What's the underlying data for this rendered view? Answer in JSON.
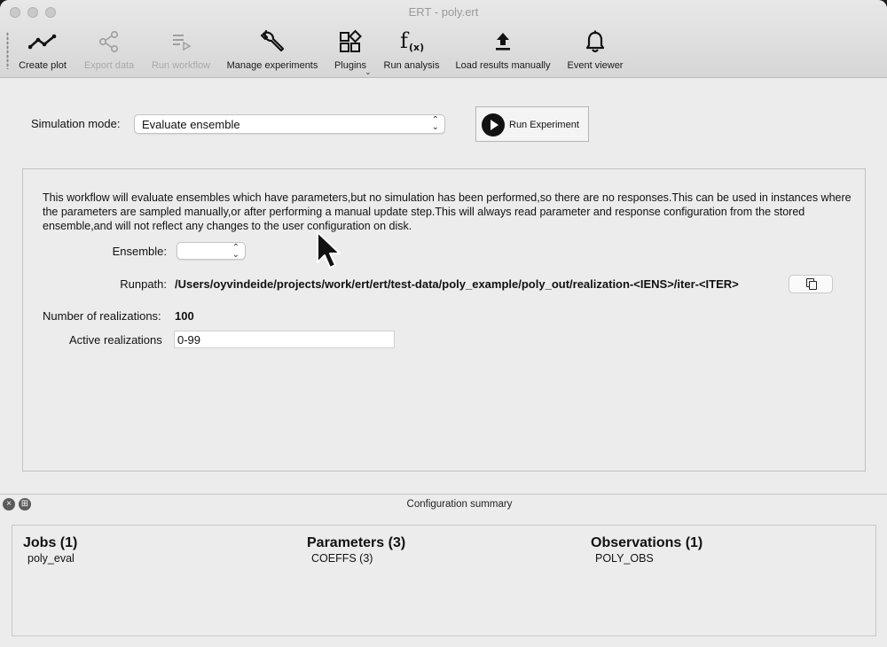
{
  "window": {
    "title": "ERT - poly.ert"
  },
  "toolbar": {
    "create_plot": "Create plot",
    "export_data": "Export data",
    "run_workflow": "Run workflow",
    "manage_experiments": "Manage experiments",
    "plugins": "Plugins",
    "run_analysis": "Run analysis",
    "load_results": "Load results manually",
    "event_viewer": "Event viewer"
  },
  "simulation": {
    "label": "Simulation mode:",
    "selected": "Evaluate ensemble",
    "run_button": "Run Experiment"
  },
  "workflow": {
    "description": "This workflow will evaluate ensembles which have parameters,but no simulation has been performed,so there are no responses.This can be used in instances where the parameters are sampled manually,or after performing a manual update step.This will always read parameter and response configuration from the stored ensemble,and will not reflect any changes to the user configuration on disk.",
    "ensemble_label": "Ensemble:",
    "ensemble_value": "",
    "runpath_label": "Runpath:",
    "runpath_value": "/Users/oyvindeide/projects/work/ert/ert/test-data/poly_example/poly_out/realization-<IENS>/iter-<ITER>",
    "num_realizations_label": "Number of realizations:",
    "num_realizations_value": "100",
    "active_realizations_label": "Active realizations",
    "active_realizations_value": "0-99"
  },
  "summary": {
    "title": "Configuration summary",
    "jobs": {
      "heading": "Jobs (1)",
      "items": [
        "poly_eval"
      ]
    },
    "parameters": {
      "heading": "Parameters (3)",
      "items": [
        "COEFFS (3)"
      ]
    },
    "observations": {
      "heading": "Observations (1)",
      "items": [
        "POLY_OBS"
      ]
    }
  }
}
